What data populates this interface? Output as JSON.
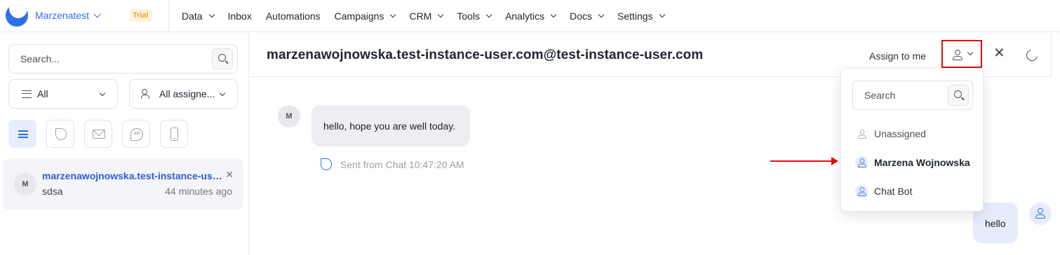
{
  "topbar": {
    "workspace": "Marzenatest",
    "trial_badge": "Trial",
    "nav": [
      "Data",
      "Inbox",
      "Automations",
      "Campaigns",
      "CRM",
      "Tools",
      "Analytics",
      "Docs",
      "Settings"
    ]
  },
  "sidebar": {
    "search_placeholder": "Search...",
    "status_filter": "All",
    "assignee_filter": "All assigne...",
    "channels": [
      "all-channels-icon",
      "chat-icon",
      "email-icon",
      "api-icon",
      "phone-icon"
    ],
    "conversation": {
      "avatar": "M",
      "title": "marzenawojnowska.test-instance-user.com@test-instance-user.com",
      "preview": "sdsa",
      "time": "44 minutes ago"
    }
  },
  "header": {
    "contact": "marzenawojnowska.test-instance-user.com@test-instance-user.com",
    "assign_to_me": "Assign to me"
  },
  "messages": {
    "incoming_avatar": "M",
    "incoming_text": "hello, hope you are well today.",
    "incoming_meta": "Sent from Chat 10:47:20 AM",
    "outgoing_text": "hello"
  },
  "assignee_dropdown": {
    "search_placeholder": "Search",
    "options": [
      "Unassigned",
      "Marzena Wojnowska",
      "Chat Bot"
    ]
  },
  "colors": {
    "accent": "#2f6fe4",
    "annotation": "#e01010"
  }
}
